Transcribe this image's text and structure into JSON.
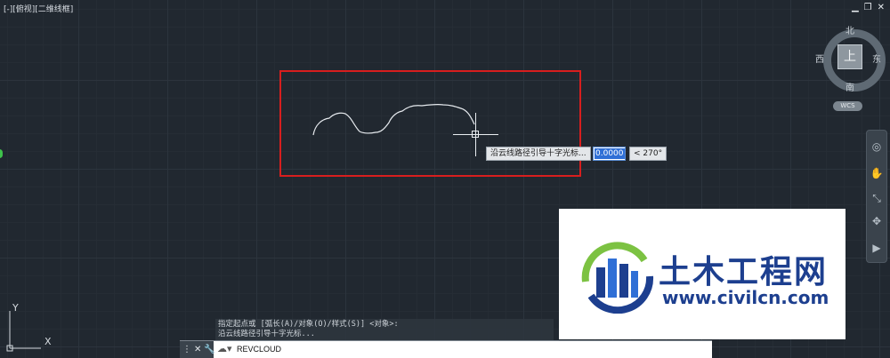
{
  "viewport": {
    "label": "[-][俯视][二维线框]"
  },
  "window_controls": {
    "minimize": "▁",
    "restore": "❐",
    "close": "✕"
  },
  "viewcube": {
    "north": "北",
    "south": "南",
    "west": "西",
    "east": "东",
    "top_face": "上",
    "wcs": "WCS"
  },
  "navbar": {
    "icons": [
      "steering-wheel-icon",
      "pan-icon",
      "zoom-icon",
      "orbit-icon",
      "showmotion-icon"
    ]
  },
  "drawing": {
    "tooltip_prompt": "沿云线路径引导十字光标...",
    "distance_value": "0.0000",
    "angle_value": "< 270°"
  },
  "ucs": {
    "y_label": "Y",
    "x_label": "X"
  },
  "command_history": [
    "指定起点或 [弧长(A)/对象(O)/样式(S)] <对象>:",
    "沿云线路径引导十字光标..."
  ],
  "command_line": {
    "current": "REVCLOUD",
    "close_label": "✕",
    "custom_label": "🔧"
  },
  "colors": {
    "background": "#212830",
    "highlight_box": "#d81e1e",
    "watermark_blue": "#1d3f8f",
    "watermark_green": "#7cc242"
  },
  "watermark": {
    "title": "土木工程网",
    "url": "www.civilcn.com"
  }
}
